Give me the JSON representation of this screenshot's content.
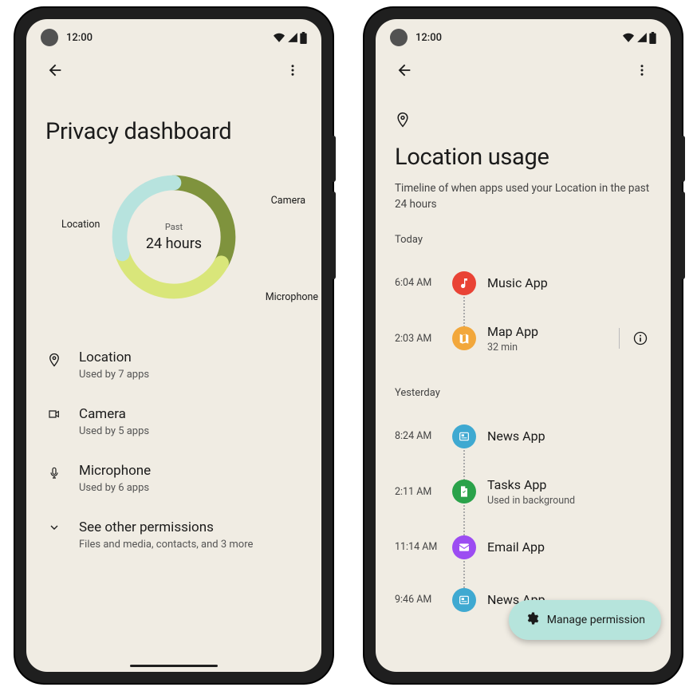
{
  "status": {
    "time": "12:00"
  },
  "left": {
    "title": "Privacy dashboard",
    "chart_center_small": "Past",
    "chart_center_big": "24 hours",
    "chart_labels": {
      "camera": "Camera",
      "location": "Location",
      "microphone": "Microphone"
    },
    "rows": {
      "location": {
        "title": "Location",
        "subtitle": "Used by 7 apps"
      },
      "camera": {
        "title": "Camera",
        "subtitle": "Used by 5 apps"
      },
      "microphone": {
        "title": "Microphone",
        "subtitle": "Used by 6 apps"
      },
      "other": {
        "title": "See other permissions",
        "subtitle": "Files and media, contacts, and 3 more"
      }
    }
  },
  "right": {
    "title": "Location usage",
    "subtitle": "Timeline of when apps used your Location in the past 24 hours",
    "sections": {
      "today": "Today",
      "yesterday": "Yesterday"
    },
    "items": {
      "music": {
        "time": "6:04 AM",
        "name": "Music App",
        "color": "#e94335"
      },
      "map": {
        "time": "2:03 AM",
        "name": "Map App",
        "sub": "32 min",
        "color": "#f2a73b"
      },
      "news1": {
        "time": "8:24 AM",
        "name": "News App",
        "color": "#3fa9d1"
      },
      "tasks": {
        "time": "2:11 AM",
        "name": "Tasks App",
        "sub": "Used in background",
        "color": "#2aa24a"
      },
      "email": {
        "time": "11:14 AM",
        "name": "Email App",
        "color": "#9c4cf2"
      },
      "news2": {
        "time": "9:46 AM",
        "name": "News App",
        "color": "#3fa9d1"
      }
    },
    "manage_label": "Manage permission"
  },
  "chart_data": {
    "type": "pie",
    "title": "Past 24 hours",
    "series": [
      {
        "name": "Camera",
        "value": 33,
        "color": "#7f933d"
      },
      {
        "name": "Microphone",
        "value": 37,
        "color": "#d9e67a"
      },
      {
        "name": "Location",
        "value": 30,
        "color": "#b7e3de"
      }
    ]
  }
}
